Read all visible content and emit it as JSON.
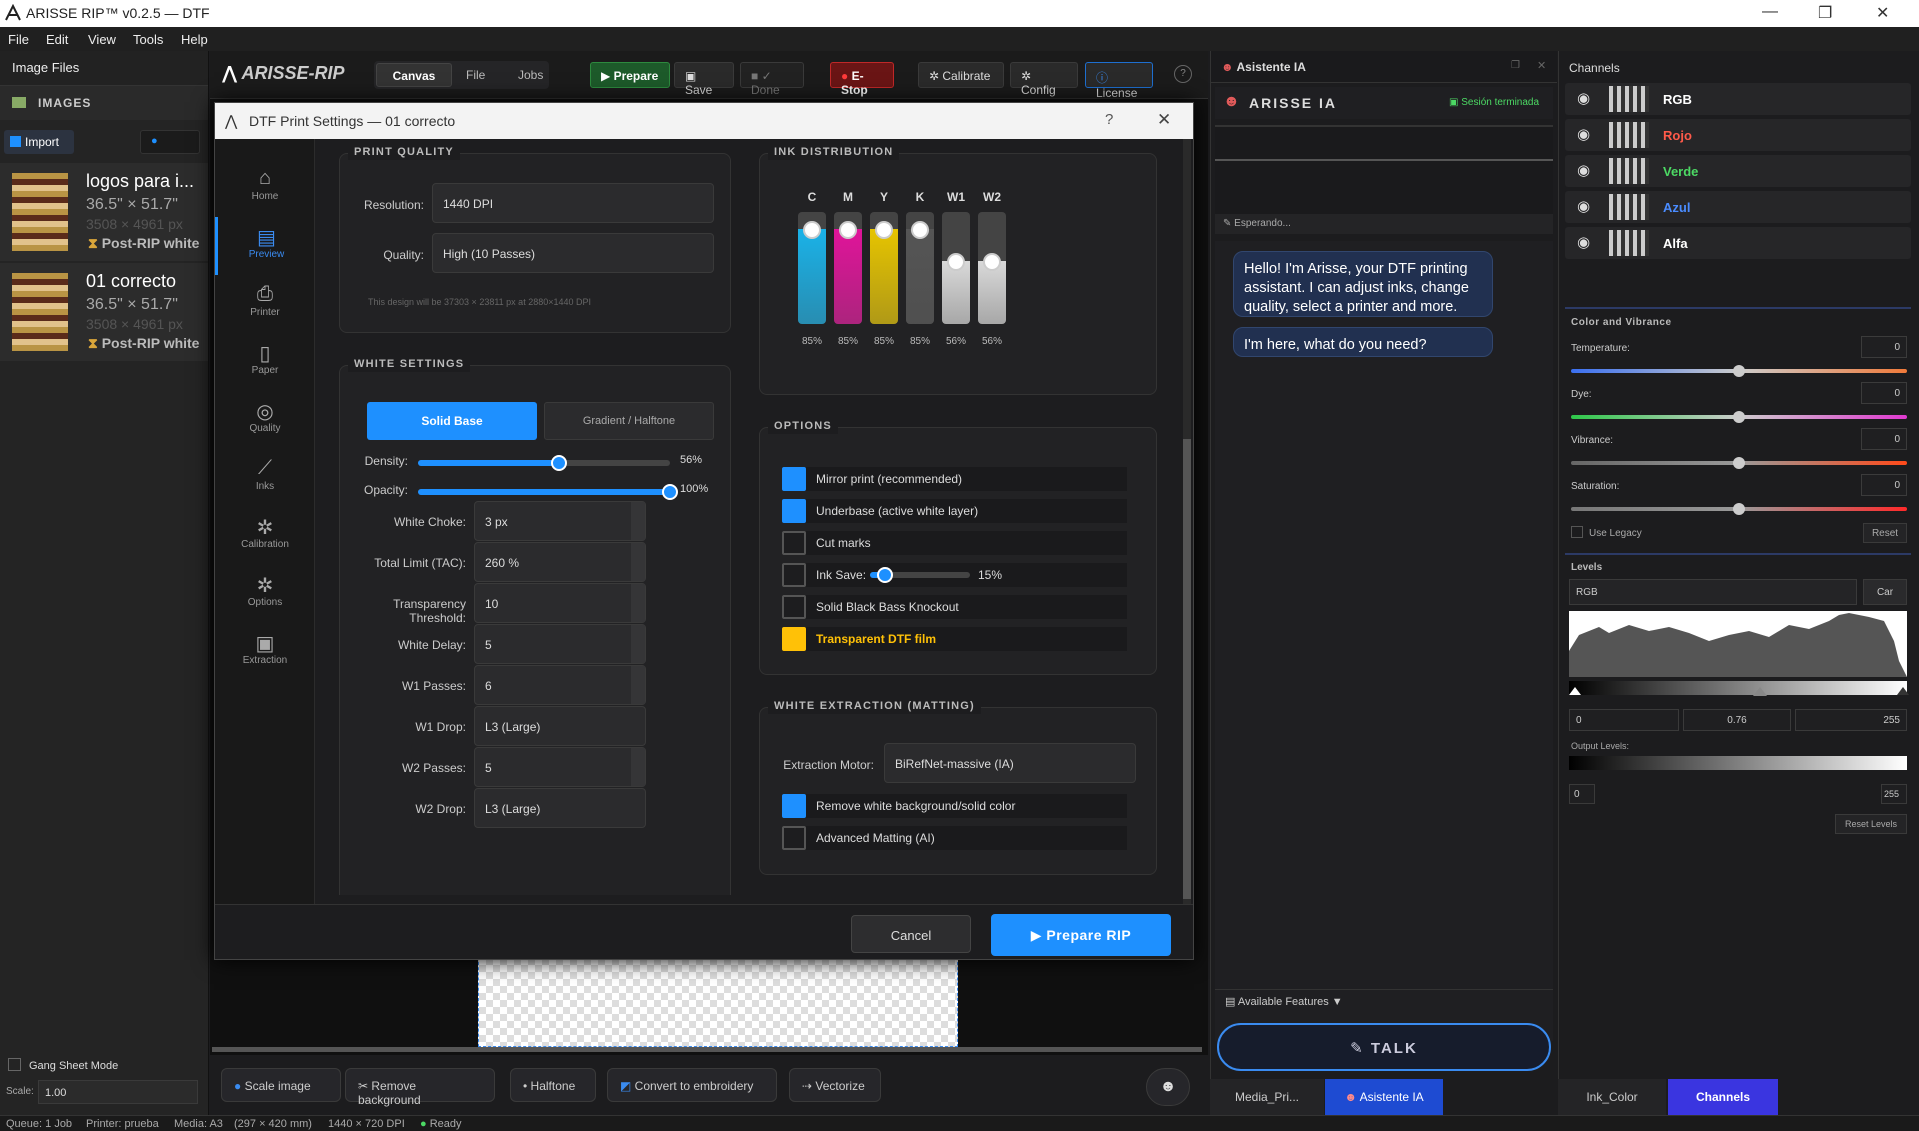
{
  "window": {
    "title": "ARISSE RIP™ v0.2.5 — DTF"
  },
  "menu": [
    "File",
    "Edit",
    "View",
    "Tools",
    "Help"
  ],
  "left": {
    "header": "Image Files",
    "section": "IMAGES",
    "import_label": "Import",
    "items": [
      {
        "name": "logos para i...",
        "size": "36.5\" × 51.7\"",
        "px": "3508 × 4961 px",
        "status": "Post-RIP white"
      },
      {
        "name": "01 correcto",
        "size": "36.5\" × 51.7\"",
        "px": "3508 × 4961 px",
        "status": "Post-RIP white"
      }
    ],
    "gang_sheet": "Gang Sheet Mode",
    "scale_label": "Scale:",
    "scale_value": "1.00"
  },
  "toolbar": {
    "brand": "ARISSE-RIP",
    "tabs": [
      "Canvas",
      "File",
      "Jobs"
    ],
    "prepare": "Prepare",
    "save": "Save",
    "done": "Done",
    "estop": "E-Stop",
    "calibrate": "Calibrate",
    "config": "Config",
    "license": "License"
  },
  "dialog": {
    "title": "DTF Print Settings — 01 correcto",
    "help": "?",
    "nav": [
      "Home",
      "Preview",
      "Printer",
      "Paper",
      "Quality",
      "Inks",
      "Calibration",
      "Options",
      "Extraction"
    ],
    "print_quality": {
      "title": "PRINT QUALITY",
      "resolution_label": "Resolution:",
      "resolution": "1440 DPI",
      "quality_label": "Quality:",
      "quality": "High (10 Passes)",
      "note": "This design will be 37303 × 23811 px at 2880×1440 DPI"
    },
    "white_settings": {
      "title": "WHITE SETTINGS",
      "solid_base": "Solid Base",
      "gradient": "Gradient / Halftone",
      "density_label": "Density:",
      "density": 0.56,
      "density_text": "56%",
      "opacity_label": "Opacity:",
      "opacity": 1.0,
      "opacity_text": "100%",
      "fields": [
        {
          "label": "White Choke:",
          "value": "3 px"
        },
        {
          "label": "Total Limit (TAC):",
          "value": "260 %"
        },
        {
          "label": "Transparency Threshold:",
          "value": "10"
        },
        {
          "label": "White Delay:",
          "value": "5"
        },
        {
          "label": "W1 Passes:",
          "value": "6"
        },
        {
          "label": "W1 Drop:",
          "value": "L3 (Large)"
        },
        {
          "label": "W2 Passes:",
          "value": "5"
        },
        {
          "label": "W2 Drop:",
          "value": "L3 (Large)"
        }
      ]
    },
    "ink_distribution": {
      "title": "INK DISTRIBUTION",
      "inks": [
        {
          "name": "C",
          "level": 0.85,
          "label": "85%",
          "color": "#1ab2e8"
        },
        {
          "name": "M",
          "level": 0.85,
          "label": "85%",
          "color": "#e0149a"
        },
        {
          "name": "Y",
          "level": 0.85,
          "label": "85%",
          "color": "#e6c400"
        },
        {
          "name": "K",
          "level": 0.85,
          "label": "85%",
          "color": "#555555"
        },
        {
          "name": "W1",
          "level": 0.56,
          "label": "56%",
          "color": "#d9d9d9"
        },
        {
          "name": "W2",
          "level": 0.56,
          "label": "56%",
          "color": "#d9d9d9"
        }
      ]
    },
    "options": {
      "title": "OPTIONS",
      "mirror": "Mirror print (recommended)",
      "underbase": "Underbase (active white layer)",
      "cut_marks": "Cut marks",
      "ink_save_label": "Ink Save:",
      "ink_save": 0.15,
      "ink_save_text": "15%",
      "knockout": "Solid Black Bass Knockout",
      "transparent_film": "Transparent DTF film"
    },
    "extraction": {
      "title": "WHITE EXTRACTION (MATTING)",
      "motor_label": "Extraction Motor:",
      "motor": "BiRefNet-massive (IA)",
      "remove_white": "Remove white background/solid color",
      "advanced": "Advanced Matting (AI)"
    },
    "cancel": "Cancel",
    "prepare_rip": "Prepare RIP"
  },
  "canvas_tools": [
    "Scale image",
    "Remove background",
    "Halftone",
    "Convert to embroidery",
    "Vectorize"
  ],
  "ai": {
    "header": "Asistente IA",
    "title": "ARISSE IA",
    "session": "Sesión terminada",
    "waiting": "Esperando...",
    "msg1": "Hello! I'm Arisse, your DTF printing assistant. I can adjust inks, change quality, select a printer and more.",
    "msg2": "I'm here, what do you need?",
    "features": "Available Features ▼",
    "talk": "TALK"
  },
  "channels": {
    "header": "Channels",
    "rows": [
      {
        "name": "RGB",
        "color": "#ffffff"
      },
      {
        "name": "Rojo",
        "color": "#ff5a4a"
      },
      {
        "name": "Verde",
        "color": "#4cd964"
      },
      {
        "name": "Azul",
        "color": "#4a8cff"
      },
      {
        "name": "Alfa",
        "color": "#ffffff"
      }
    ],
    "color_vibrance": "Color and Vibrance",
    "temperature": "Temperature:",
    "dye": "Dye:",
    "vibrance": "Vibrance:",
    "saturation": "Saturation:",
    "zero": "0",
    "legacy": "Use Legacy",
    "reset": "Reset",
    "levels": "Levels",
    "levels_channel": "RGB",
    "car": "Car",
    "in_low": "0",
    "gamma": "0.76",
    "in_high": "255",
    "output_levels": "Output Levels:",
    "out_low": "0",
    "out_high": "255",
    "reset_levels": "Reset Levels"
  },
  "bottom_tabs": [
    "Media_Pri...",
    "Asistente IA",
    "Ink_Color",
    "Channels"
  ],
  "status": {
    "queue": "Queue: 1 Job",
    "printer": "Printer: prueba",
    "media": "Media: A3",
    "mm": "(297 × 420 mm)",
    "dpi": "1440 × 720 DPI",
    "ready": "Ready"
  }
}
